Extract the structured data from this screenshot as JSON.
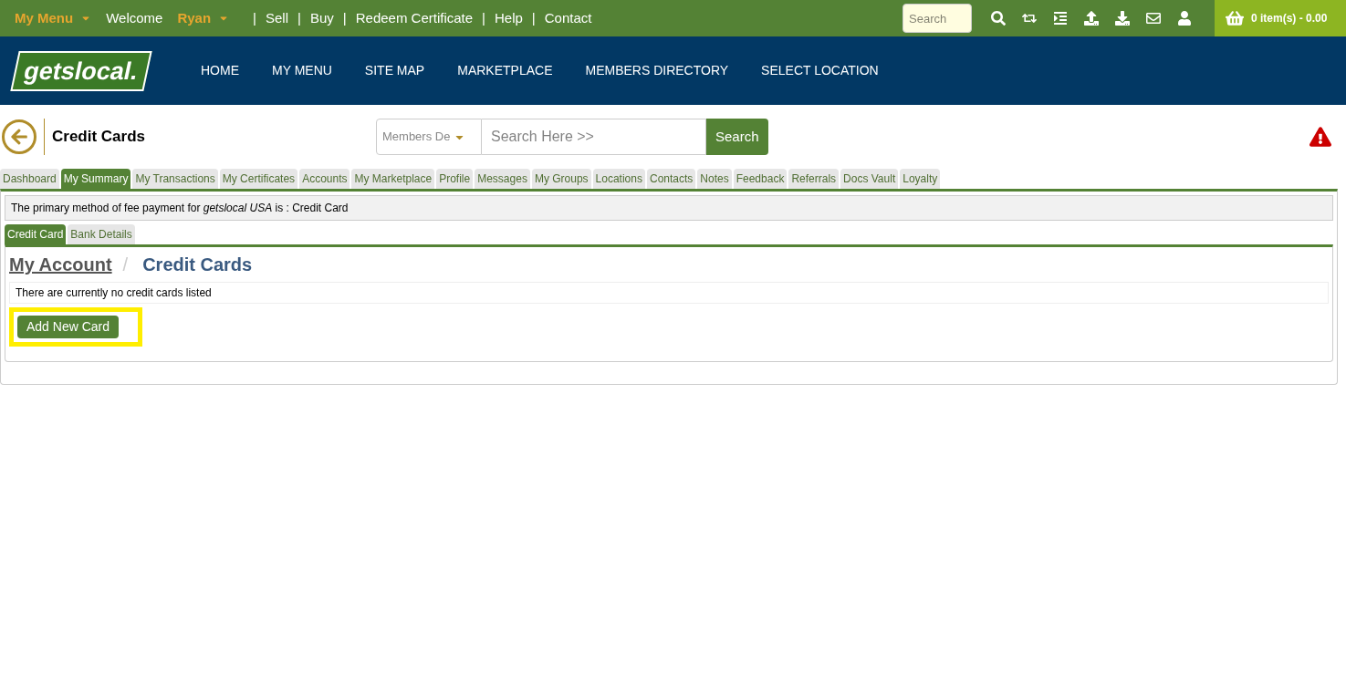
{
  "top_bar": {
    "items": [
      {
        "label": "My Menu",
        "kind": "menu"
      },
      {
        "label": "Welcome",
        "kind": "text"
      },
      {
        "label": "Ryan",
        "kind": "menu"
      },
      {
        "label": "|",
        "kind": "separator"
      },
      {
        "label": "Sell",
        "kind": "link"
      },
      {
        "label": "|",
        "kind": "separator"
      },
      {
        "label": "Buy",
        "kind": "link"
      },
      {
        "label": "|",
        "kind": "separator"
      },
      {
        "label": "Redeem Certificate",
        "kind": "link"
      },
      {
        "label": "|",
        "kind": "separator"
      },
      {
        "label": "Help",
        "kind": "link"
      },
      {
        "label": "|",
        "kind": "separator"
      },
      {
        "label": "Contact",
        "kind": "link"
      }
    ],
    "search": {
      "placeholder": "Search"
    },
    "cart": "0 item(s) - 0.00"
  },
  "logo": "getslocal.",
  "nav": [
    "HOME",
    "MY MENU",
    "SITE MAP",
    "MARKETPLACE",
    "MEMBERS DIRECTORY",
    "SELECT LOCATION"
  ],
  "page_title": "Credit Cards",
  "search": {
    "category": "Members De",
    "placeholder": "Search Here >>",
    "button": "Search"
  },
  "tabs": [
    {
      "label": "Dashboard",
      "selected": false
    },
    {
      "label": "My Summary",
      "selected": true
    },
    {
      "label": "My Transactions",
      "selected": false
    },
    {
      "label": "My Certificates",
      "selected": false
    },
    {
      "label": "Accounts",
      "selected": false
    },
    {
      "label": "My Marketplace",
      "selected": false
    },
    {
      "label": "Profile",
      "selected": false
    },
    {
      "label": "Messages",
      "selected": false
    },
    {
      "label": "My Groups",
      "selected": false
    },
    {
      "label": "Locations",
      "selected": false
    },
    {
      "label": "Contacts",
      "selected": false
    },
    {
      "label": "Notes",
      "selected": false
    },
    {
      "label": "Feedback",
      "selected": false
    },
    {
      "label": "Referrals",
      "selected": false
    },
    {
      "label": "Docs Vault",
      "selected": false
    },
    {
      "label": "Loyalty",
      "selected": false
    }
  ],
  "notice": "The primary method of fee payment for *getslocal USA* is : Credit Card",
  "sub_tabs": [
    {
      "label": "Credit Card",
      "selected": true
    },
    {
      "label": "Bank Details",
      "selected": false
    }
  ],
  "breadcrumb": {
    "parent": "My Account",
    "separator": "/",
    "current": "Credit Cards"
  },
  "empty_message": "There are currently no credit cards listed",
  "add_button": {
    "label": "Add New Card",
    "highlighted": true
  }
}
